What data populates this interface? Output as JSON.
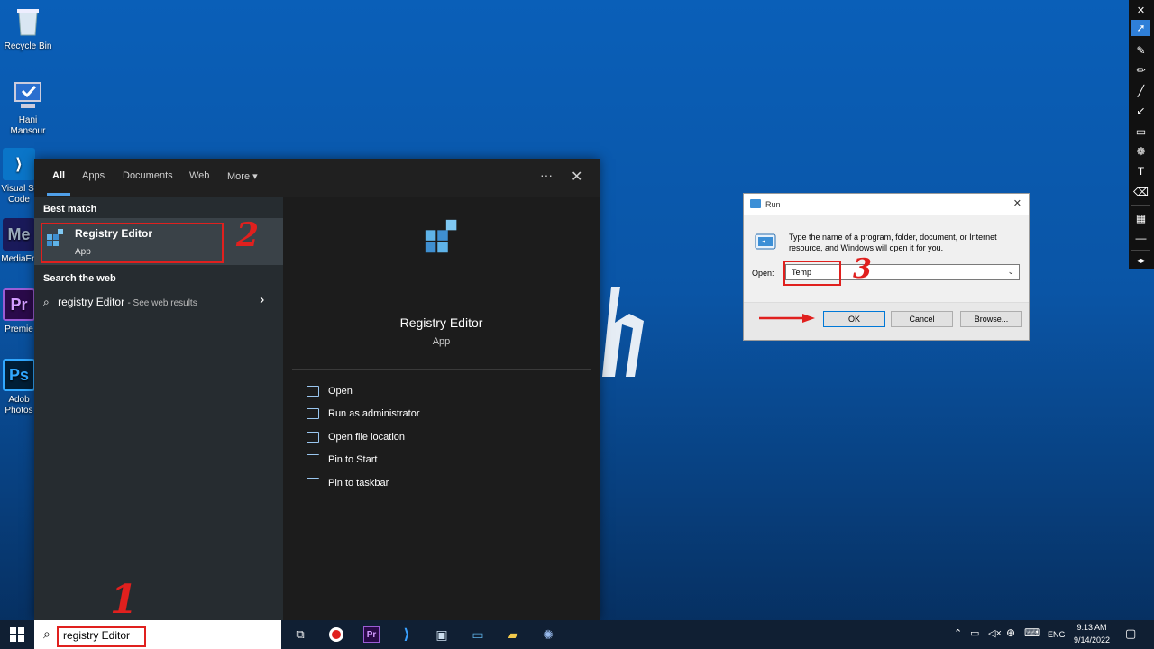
{
  "desktop": {
    "icons": [
      {
        "label": "Recycle Bin"
      },
      {
        "label": "Hani Mansour"
      },
      {
        "label": "Visual St Code"
      },
      {
        "label": "MediaEn"
      },
      {
        "label": "Premie"
      },
      {
        "label": "Adob Photos"
      }
    ]
  },
  "search_flyout": {
    "tabs": [
      "All",
      "Apps",
      "Documents",
      "Web",
      "More"
    ],
    "more_icon": "ellipsis-icon",
    "close_icon": "close-icon",
    "best_match_heading": "Best match",
    "best_match": {
      "title": "Registry Editor",
      "subtitle": "App"
    },
    "search_web_heading": "Search the web",
    "web_result": {
      "query": "registry Editor",
      "suffix": "- See web results"
    },
    "detail": {
      "title": "Registry Editor",
      "subtitle": "App",
      "actions": [
        "Open",
        "Run as administrator",
        "Open file location",
        "Pin to Start",
        "Pin to taskbar"
      ]
    }
  },
  "annotations": {
    "one": "1",
    "two": "2",
    "three": "3"
  },
  "run_dialog": {
    "title": "Run",
    "description": "Type the name of a program, folder, document, or Internet resource, and Windows will open it for you.",
    "open_label": "Open:",
    "input_value": "Temp",
    "ok_label": "OK",
    "cancel_label": "Cancel",
    "browse_label": "Browse..."
  },
  "taskbar": {
    "search_value": "registry Editor",
    "language": "ENG",
    "time": "9:13 AM",
    "date": "9/14/2022"
  },
  "colors": {
    "desktop_blue": "#0a5fb8",
    "accent": "#4f9fe8",
    "annotation_red": "#e0201e"
  }
}
